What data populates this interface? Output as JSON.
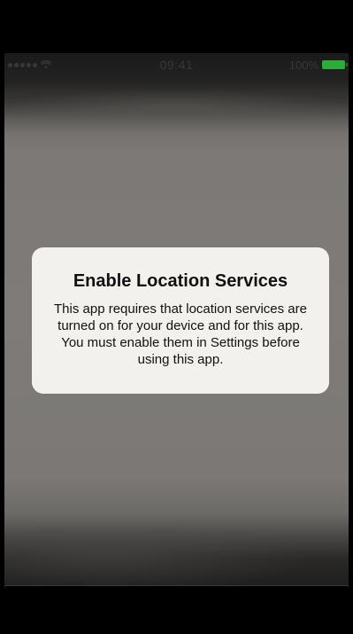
{
  "status_bar": {
    "time": "09:41",
    "battery_percent": "100%",
    "signal_bars": 5,
    "battery_color": "#2ebd3f"
  },
  "alert": {
    "title": "Enable Location Services",
    "message": "This app requires that location services are turned on for your device and for this app. You must enable them in Settings before using this app."
  },
  "icons": {
    "wifi": "wifi-icon",
    "battery": "battery-icon",
    "signal": "signal-icon"
  }
}
